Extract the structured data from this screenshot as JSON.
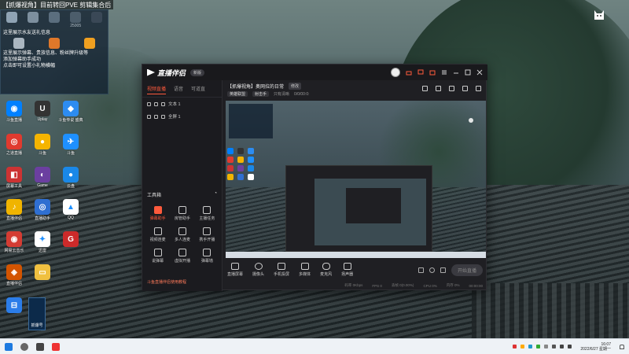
{
  "overlay": {
    "title": "【抓爆视角】目前转回PVE 剪辑集合后",
    "widget_tabs": [
      "",
      "",
      "",
      "25005",
      ""
    ],
    "row1_labels": [
      "",
      "",
      "",
      ""
    ],
    "messages": [
      "这里展示水友送礼信息",
      "这里展示弹幕、贵族信息、粉丝牌升级等",
      "添加弹幕助手成功",
      "点击即可设置小礼物横幅"
    ]
  },
  "desktop_icons": [
    {
      "label": "斗鱼直播",
      "color": "#0080ff",
      "glyph": "◉"
    },
    {
      "label": "Uplay",
      "color": "#333333",
      "glyph": "U"
    },
    {
      "label": "斗鱼传说\n盛典",
      "color": "#2d8cf0",
      "glyph": "◆"
    },
    {
      "label": "之道直播",
      "color": "#e03a2f",
      "glyph": "◎"
    },
    {
      "label": "斗鱼",
      "color": "#f5b400",
      "glyph": "●"
    },
    {
      "label": "斗鱼",
      "color": "#1e90ff",
      "glyph": "✈"
    },
    {
      "label": "屏幕工具",
      "color": "#cc3333",
      "glyph": "◧"
    },
    {
      "label": "Game",
      "color": "#6b3fa0",
      "glyph": "◐"
    },
    {
      "label": "云盘",
      "color": "#1a88e8",
      "glyph": "●"
    },
    {
      "label": "直播伴侣",
      "color": "#f0b400",
      "glyph": "♪"
    },
    {
      "label": "直播助手",
      "color": "#2f6fd1",
      "glyph": "◎"
    },
    {
      "label": "QQ",
      "color": "#ffffff",
      "glyph": "▲"
    },
    {
      "label": "网易云音乐",
      "color": "#d43c33",
      "glyph": "◉"
    },
    {
      "label": "迅雷",
      "color": "#ffffff",
      "glyph": "✦"
    },
    {
      "label": "",
      "color": "#cc2a2a",
      "glyph": "G"
    },
    {
      "label": "直播伴侣",
      "color": "#d35400",
      "glyph": "◈"
    },
    {
      "label": "",
      "color": "#f0c040",
      "glyph": "▭"
    },
    {
      "label": "",
      "color": "#2b7de9",
      "glyph": "⊟"
    }
  ],
  "desktop_card": {
    "label": "抓爆号"
  },
  "app": {
    "name": "直播伴侣",
    "version": "新版",
    "left_tabs": [
      "视频直播",
      "语音",
      "可道直"
    ],
    "scenes": [
      "文本 1",
      "全屏 1"
    ],
    "tools_label": "工具箱",
    "tools": [
      {
        "label": "弹幕助手",
        "active": true
      },
      {
        "label": "房管助手",
        "active": false
      },
      {
        "label": "主播任务",
        "active": false
      },
      {
        "label": "视频连麦",
        "active": false
      },
      {
        "label": "多人连麦",
        "active": false
      },
      {
        "label": "携手开播",
        "active": false
      },
      {
        "label": "说弹幕",
        "active": false
      },
      {
        "label": "虚拟开播",
        "active": false
      },
      {
        "label": "弹幕墙",
        "active": false
      }
    ],
    "left_footer": "斗鱼直播伴侣使用教程",
    "stream_title": "【抓爆视角】奥网拉的日常",
    "stream_pill": "修改",
    "stream_tags": [
      "英雄联盟",
      "射击手"
    ],
    "stream_meta": [
      "只有清晰",
      "0/0/00:0:"
    ],
    "controls": [
      "直播屏幕",
      "摄像头",
      "手机投屏",
      "多媒体",
      "麦克风",
      "扬声器"
    ],
    "live_button": "开始直播",
    "status": [
      "码率 0Kbps",
      "FPS 0",
      "丢帧 0(0.00%)",
      "CPU 0%",
      "内存 0%",
      "00:00:00"
    ]
  },
  "taskbar": {
    "time": "16:07",
    "date": "2022/6/27 星期一"
  },
  "colors": {
    "accent": "#ff5a3c",
    "app_bg": "#1f1f23",
    "taskbar_bg": "#eef2f6"
  }
}
